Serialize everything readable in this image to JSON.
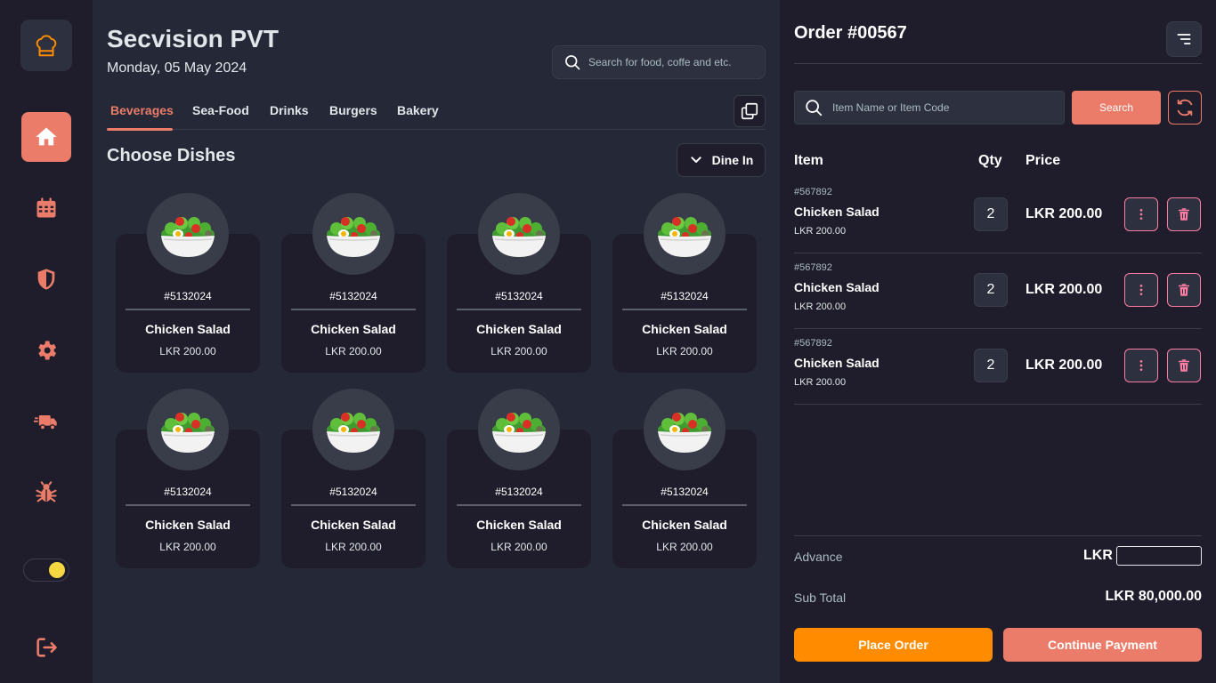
{
  "header": {
    "title": "Secvision PVT",
    "date": "Monday, 05 May 2024"
  },
  "search": {
    "placeholder": "Search for food, coffe and etc."
  },
  "tabs": [
    {
      "label": "Beverages",
      "active": true
    },
    {
      "label": "Sea-Food"
    },
    {
      "label": "Drinks"
    },
    {
      "label": "Burgers"
    },
    {
      "label": "Bakery"
    }
  ],
  "dishes_section": {
    "title": "Choose Dishes",
    "dine_option": "Dine In"
  },
  "dishes": [
    {
      "code": "#5132024",
      "name": "Chicken Salad",
      "price": "LKR 200.00",
      "icon": "salad-icon"
    },
    {
      "code": "#5132024",
      "name": "Chicken Salad",
      "price": "LKR 200.00",
      "icon": "salad-icon"
    },
    {
      "code": "#5132024",
      "name": "Chicken Salad",
      "price": "LKR 200.00",
      "icon": "salad-icon"
    },
    {
      "code": "#5132024",
      "name": "Chicken Salad",
      "price": "LKR 200.00",
      "icon": "salad-icon"
    },
    {
      "code": "#5132024",
      "name": "Chicken Salad",
      "price": "LKR 200.00",
      "icon": "salad-icon"
    },
    {
      "code": "#5132024",
      "name": "Chicken Salad",
      "price": "LKR 200.00",
      "icon": "salad-icon"
    },
    {
      "code": "#5132024",
      "name": "Chicken Salad",
      "price": "LKR 200.00",
      "icon": "salad-icon"
    },
    {
      "code": "#5132024",
      "name": "Chicken Salad",
      "price": "LKR 200.00",
      "icon": "salad-icon"
    }
  ],
  "sidebar": {
    "logo_icon": "chef-hat-icon",
    "items": [
      {
        "icon": "home-icon",
        "active": true
      },
      {
        "icon": "calendar-icon"
      },
      {
        "icon": "shield-icon"
      },
      {
        "icon": "gear-icon"
      },
      {
        "icon": "delivery-truck-icon"
      },
      {
        "icon": "bug-icon"
      }
    ],
    "theme_toggle_icon": "sun-icon",
    "logout_icon": "logout-icon"
  },
  "order": {
    "title": "Order #00567",
    "search_placeholder": "Item Name or Item Code",
    "search_button": "Search",
    "columns": {
      "item": "Item",
      "qty": "Qty",
      "price": "Price"
    },
    "rows": [
      {
        "code": "#567892",
        "name": "Chicken Salad",
        "unit_price": "LKR 200.00",
        "qty": "2",
        "price": "LKR 200.00"
      },
      {
        "code": "#567892",
        "name": "Chicken Salad",
        "unit_price": "LKR 200.00",
        "qty": "2",
        "price": "LKR 200.00"
      },
      {
        "code": "#567892",
        "name": "Chicken Salad",
        "unit_price": "LKR 200.00",
        "qty": "2",
        "price": "LKR 200.00"
      }
    ],
    "advance_label": "Advance",
    "advance_currency": "LKR",
    "advance_value": "",
    "subtotal_label": "Sub Total",
    "subtotal_value": "LKR 80,000.00",
    "place_order": "Place Order",
    "continue_payment": "Continue Payment"
  },
  "colors": {
    "accent": "#ea7c69",
    "orange": "#ff8c00",
    "pink": "#ff7ca3",
    "bg": "#252836",
    "panel": "#1f1d2b"
  }
}
